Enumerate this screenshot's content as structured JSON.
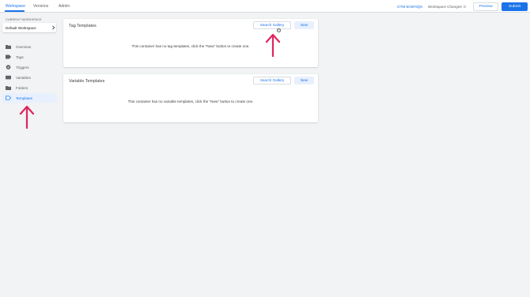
{
  "header": {
    "tabs": [
      {
        "label": "Workspace",
        "active": true
      },
      {
        "label": "Versions",
        "active": false
      },
      {
        "label": "Admin",
        "active": false
      }
    ],
    "container_id": "GTM-5G5F6QK",
    "workspace_changes": "Workspace Changes: 0",
    "preview_label": "Preview",
    "submit_label": "Submit"
  },
  "sidebar": {
    "current_workspace_label": "CURRENT WORKSPACE",
    "workspace_name": "Default Workspace",
    "items": [
      {
        "label": "Overview",
        "icon": "folder-icon",
        "active": false
      },
      {
        "label": "Tags",
        "icon": "tag-icon",
        "active": false
      },
      {
        "label": "Triggers",
        "icon": "trigger-icon",
        "active": false
      },
      {
        "label": "Variables",
        "icon": "variables-icon",
        "active": false
      },
      {
        "label": "Folders",
        "icon": "folder-icon",
        "active": false
      },
      {
        "label": "Templates",
        "icon": "template-icon",
        "active": true
      }
    ]
  },
  "tag_templates": {
    "title": "Tag Templates",
    "search_gallery_label": "Search Gallery",
    "new_label": "New",
    "empty_message": "This container has no tag templates, click the \"New\" button to create one."
  },
  "variable_templates": {
    "title": "Variable Templates",
    "search_gallery_label": "Search Gallery",
    "new_label": "New",
    "empty_message": "This container has no variable templates, click the \"New\" button to create one."
  },
  "colors": {
    "accent": "#1a73e8",
    "active_nav_bg": "#e8f0fe",
    "annotation_arrow": "#e0245e",
    "page_bg": "#f1f3f4"
  }
}
